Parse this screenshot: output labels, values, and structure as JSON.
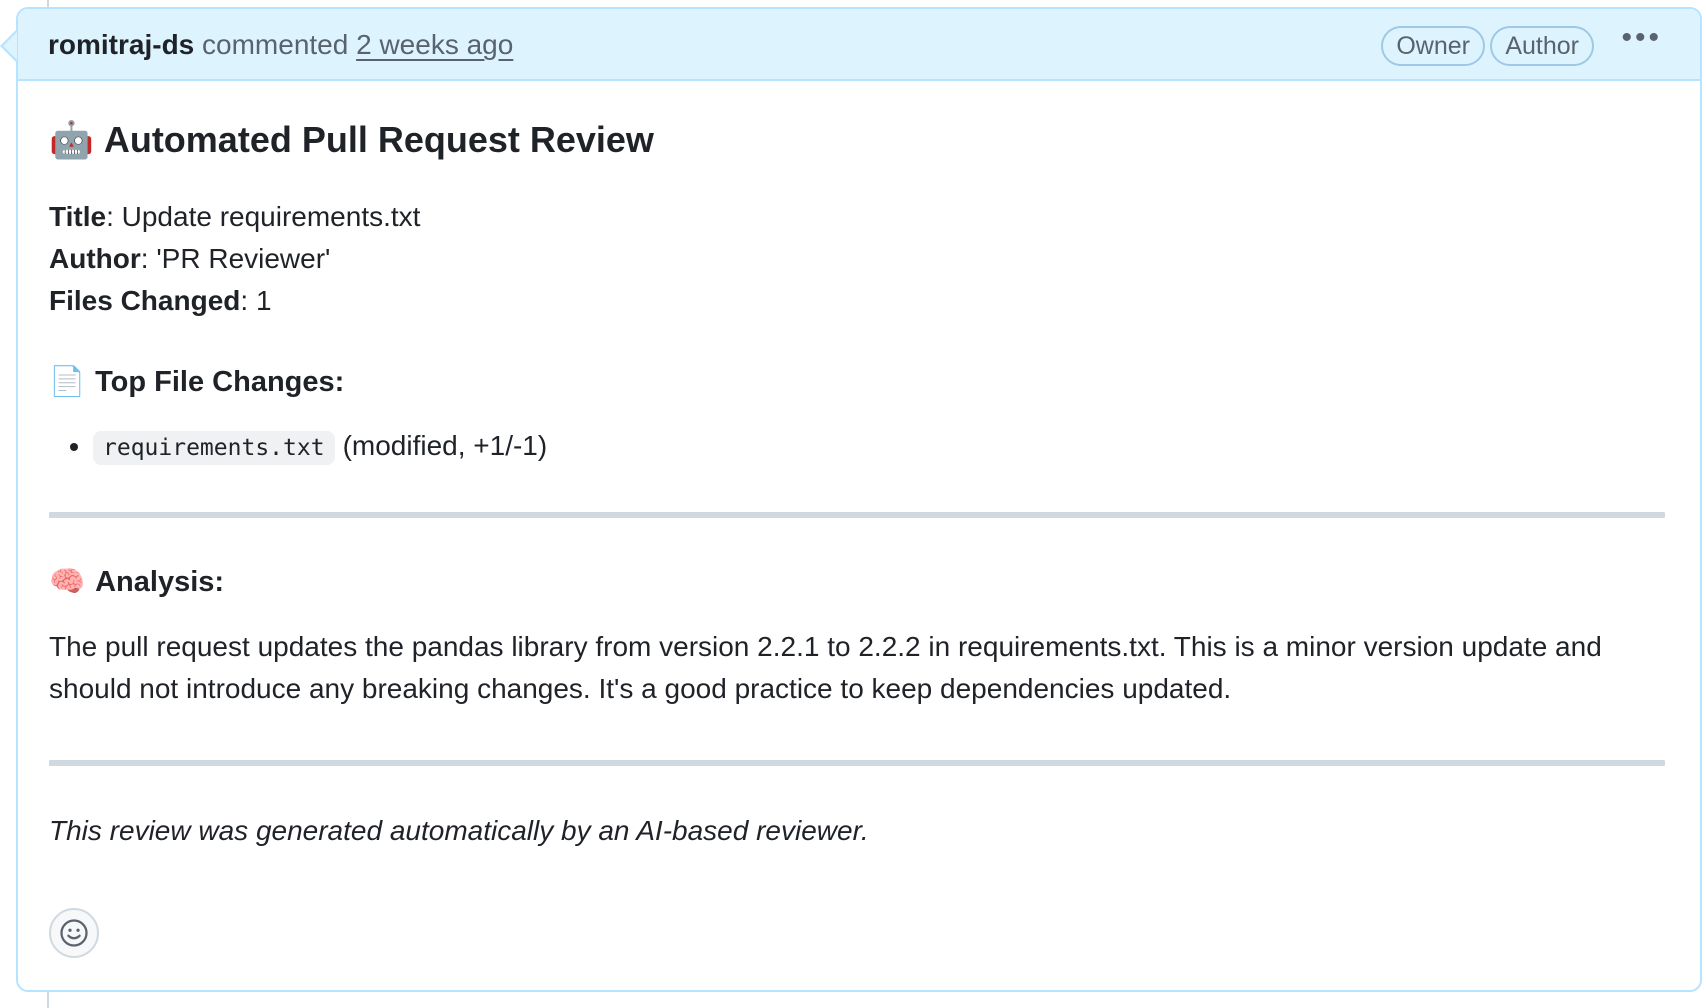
{
  "comment": {
    "author": "romitraj-ds",
    "action": "commented",
    "time": "2 weeks ago",
    "badges": [
      "Owner",
      "Author"
    ],
    "menu_icon": "kebab-horizontal-icon"
  },
  "review": {
    "heading_emoji": "🤖",
    "heading": "Automated Pull Request Review",
    "meta": {
      "title_label": "Title",
      "title_value": "Update requirements.txt",
      "author_label": "Author",
      "author_value": "'PR Reviewer'",
      "files_label": "Files Changed",
      "files_value": "1"
    },
    "top_files": {
      "emoji": "📄",
      "heading": "Top File Changes:",
      "items": [
        {
          "file": "requirements.txt",
          "detail": "(modified, +1/-1)"
        }
      ]
    },
    "analysis": {
      "emoji": "🧠",
      "heading": "Analysis:",
      "text": "The pull request updates the pandas library from version 2.2.1 to 2.2.2 in requirements.txt. This is a minor version update and should not introduce any breaking changes. It's a good practice to keep dependencies updated."
    },
    "footer_note": "This review was generated automatically by an AI-based reviewer."
  },
  "reaction_icon": "smiley-icon",
  "colors": {
    "header_bg": "#ddf4ff",
    "header_border": "#b6e3ff",
    "text": "#1f2328",
    "muted": "#59636e"
  }
}
